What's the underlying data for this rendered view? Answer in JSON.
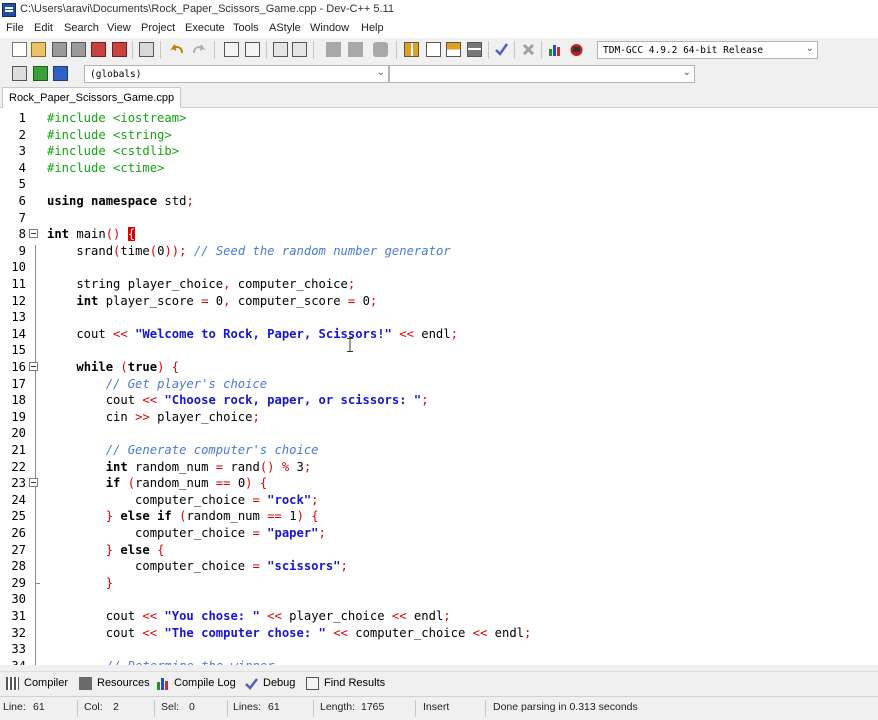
{
  "window": {
    "title": "C:\\Users\\aravi\\Documents\\Rock_Paper_Scissors_Game.cpp - Dev-C++ 5.11"
  },
  "menu": [
    "File",
    "Edit",
    "Search",
    "View",
    "Project",
    "Execute",
    "Tools",
    "AStyle",
    "Window",
    "Help"
  ],
  "toolbar": {
    "compiler_select": "TDM-GCC 4.9.2 64-bit Release",
    "scope_select": "(globals)",
    "member_select": "",
    "icons": [
      "new-file-icon",
      "open-file-icon",
      "save-icon",
      "save-all-icon",
      "close-icon",
      "close-all-icon",
      "print-icon",
      "undo-icon",
      "redo-icon",
      "find-icon",
      "replace-icon",
      "indent-icon",
      "unindent-icon",
      "back-icon",
      "forward-icon",
      "toggle-bookmark-icon",
      "compile-icon",
      "run-icon",
      "compile-run-icon",
      "rebuild-icon",
      "check-icon",
      "stop-icon",
      "chart-icon",
      "debug-icon",
      "new-project-icon",
      "insert-icon",
      "bookmark-icon"
    ]
  },
  "editor": {
    "tab_label": "Rock_Paper_Scissors_Game.cpp",
    "line_numbers": [
      "1",
      "2",
      "3",
      "4",
      "5",
      "6",
      "7",
      "8",
      "9",
      "10",
      "11",
      "12",
      "13",
      "14",
      "15",
      "16",
      "17",
      "18",
      "19",
      "20",
      "21",
      "22",
      "23",
      "24",
      "25",
      "26",
      "27",
      "28",
      "29",
      "30",
      "31",
      "32",
      "33",
      "34"
    ],
    "lines": [
      "#include <iostream>",
      "#include <string>",
      "#include <cstdlib>",
      "#include <ctime>",
      "",
      "using namespace std;",
      "",
      "int main() {",
      "    srand(time(0)); // Seed the random number generator",
      "",
      "    string player_choice, computer_choice;",
      "    int player_score = 0, computer_score = 0;",
      "",
      "    cout << \"Welcome to Rock, Paper, Scissors!\" << endl;",
      "",
      "    while (true) {",
      "        // Get player's choice",
      "        cout << \"Choose rock, paper, or scissors: \";",
      "        cin >> player_choice;",
      "",
      "        // Generate computer's choice",
      "        int random_num = rand() % 3;",
      "        if (random_num == 0) {",
      "            computer_choice = \"rock\";",
      "        } else if (random_num == 1) {",
      "            computer_choice = \"paper\";",
      "        } else {",
      "            computer_choice = \"scissors\";",
      "        }",
      "",
      "        cout << \"You chose: \" << player_choice << endl;",
      "        cout << \"The computer chose: \" << computer_choice << endl;",
      "",
      "        // Determine the winner"
    ]
  },
  "bottom_tabs": [
    {
      "label": "Compiler",
      "icon": "compiler-icon"
    },
    {
      "label": "Resources",
      "icon": "resources-icon"
    },
    {
      "label": "Compile Log",
      "icon": "compile-log-icon"
    },
    {
      "label": "Debug",
      "icon": "debug-check-icon"
    },
    {
      "label": "Find Results",
      "icon": "find-results-icon"
    }
  ],
  "status": {
    "line_label": "Line:",
    "line_value": "61",
    "col_label": "Col:",
    "col_value": "2",
    "sel_label": "Sel:",
    "sel_value": "0",
    "lines_label": "Lines:",
    "lines_value": "61",
    "length_label": "Length:",
    "length_value": "1765",
    "mode": "Insert",
    "message": "Done parsing in 0.313 seconds"
  },
  "colors": {
    "preprocessor": "#13a513",
    "string": "#1515d8",
    "comment": "#4a7ad8",
    "symbol": "#e00000"
  }
}
